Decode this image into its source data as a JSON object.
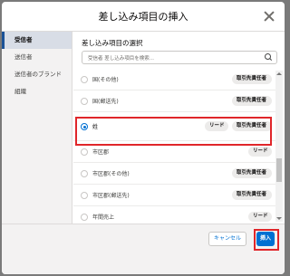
{
  "modal": {
    "title": "差し込み項目の挿入"
  },
  "sidebar": {
    "items": [
      {
        "label": "受信者",
        "active": true
      },
      {
        "label": "送信者"
      },
      {
        "label": "送信者のブランド"
      },
      {
        "label": "組織"
      }
    ]
  },
  "main": {
    "section_title": "差し込み項目の選択",
    "search": {
      "placeholder": "受信者 差し込み項目を検索..."
    }
  },
  "fields": [
    {
      "label": "国(その他)",
      "badges": [
        "取引先責任者"
      ]
    },
    {
      "label": "国(郵送先)",
      "badges": [
        "取引先責任者"
      ]
    },
    {
      "label": "姓",
      "badges": [
        "リード",
        "取引先責任者"
      ],
      "selected": true
    },
    {
      "label": "市区郡",
      "badges": [
        "リード"
      ]
    },
    {
      "label": "市区郡(その他)",
      "badges": [
        "取引先責任者"
      ]
    },
    {
      "label": "市区郡(郵送先)",
      "badges": [
        "取引先責任者"
      ]
    },
    {
      "label": "年間売上",
      "badges": [
        "リード"
      ]
    },
    {
      "label": "役職",
      "badges": [
        "リード",
        "取引先責任者"
      ]
    }
  ],
  "footer": {
    "cancel_label": "キャンセル",
    "insert_label": "挿入"
  },
  "colors": {
    "brand": "#0070d2",
    "highlight": "#e0262a"
  }
}
